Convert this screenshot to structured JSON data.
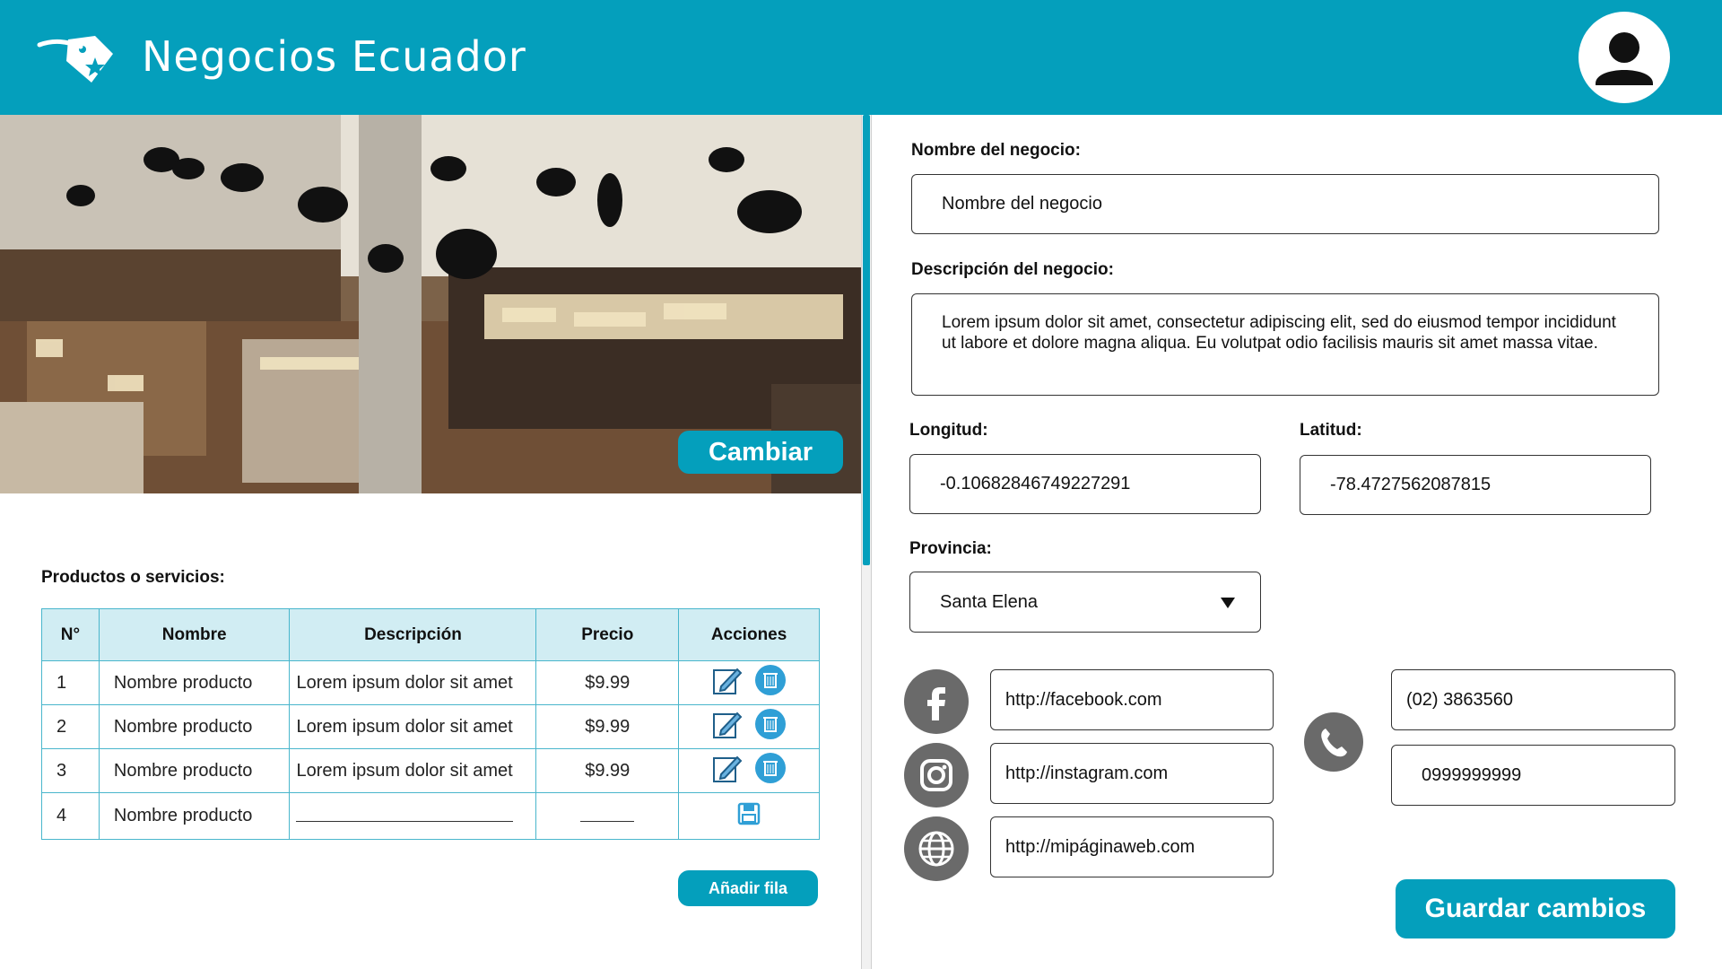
{
  "app": {
    "title": "Negocios Ecuador"
  },
  "header": {
    "logo_icon": "tag-star-icon",
    "avatar_icon": "user-avatar-icon"
  },
  "hero": {
    "change_label": "Cambiar"
  },
  "products": {
    "section_label": "Productos o servicios:",
    "columns": [
      "N°",
      "Nombre",
      "Descripción",
      "Precio",
      "Acciones"
    ],
    "rows": [
      {
        "n": "1",
        "name": "Nombre producto",
        "description": "Lorem ipsum dolor sit amet",
        "price": "$9.99"
      },
      {
        "n": "2",
        "name": "Nombre producto",
        "description": "Lorem ipsum dolor sit amet",
        "price": "$9.99"
      },
      {
        "n": "3",
        "name": "Nombre producto",
        "description": "Lorem ipsum dolor sit amet",
        "price": "$9.99"
      },
      {
        "n": "4",
        "name": "Nombre producto",
        "description": "",
        "price": ""
      }
    ],
    "add_row_label": "Añadir fila"
  },
  "form": {
    "name_label": "Nombre del negocio:",
    "name_value": "Nombre del negocio",
    "description_label": "Descripción del negocio:",
    "description_value": "Lorem ipsum dolor sit amet, consectetur adipiscing elit, sed do eiusmod tempor incididunt ut labore et dolore magna aliqua. Eu volutpat odio facilisis mauris sit amet massa vitae.",
    "longitude_label": "Longitud:",
    "longitude_value": "-0.10682846749227291",
    "latitude_label": "Latitud:",
    "latitude_value": "-78.4727562087815",
    "province_label": "Provincia:",
    "province_value": "Santa Elena",
    "facebook_value": "http://facebook.com",
    "instagram_value": "http://instagram.com",
    "website_value": "http://mipáginaweb.com",
    "phone_value": "(02) 3863560",
    "mobile_value": "0999999999",
    "save_label": "Guardar cambios"
  },
  "colors": {
    "accent": "#049fbc",
    "header_bg": "#049fbc",
    "table_header_bg": "#d1edf3",
    "icon_gray": "#6a6a6a"
  }
}
